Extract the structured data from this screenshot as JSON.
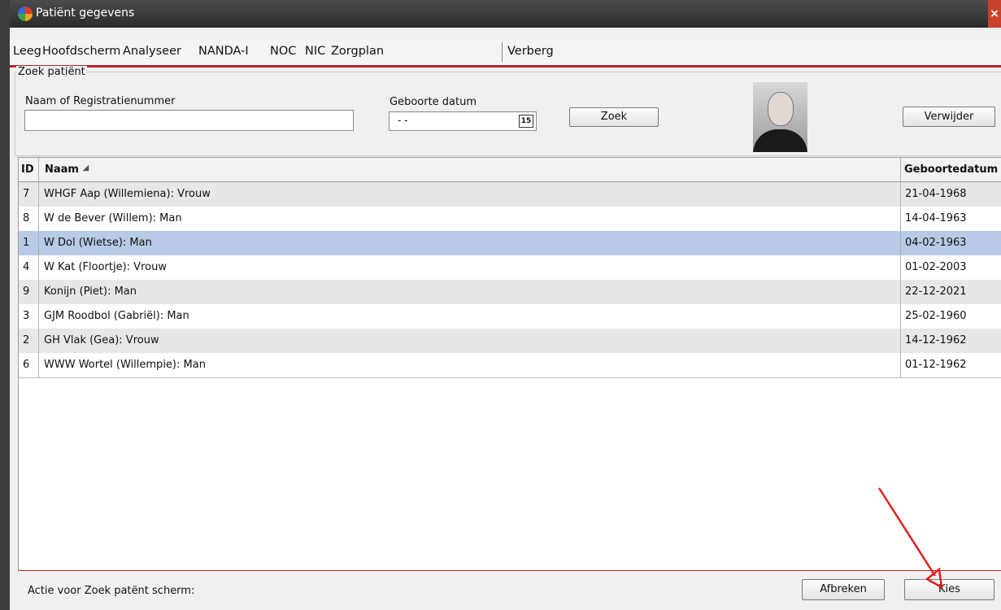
{
  "window": {
    "title": "Patiënt gegevens",
    "close": "×"
  },
  "menu": {
    "items": [
      "Leeg",
      "Hoofdscherm",
      "Analyseer",
      "NANDA-I",
      "NOC",
      "NIC",
      "Zorgplan",
      "Verberg"
    ]
  },
  "search": {
    "group_label": "Zoek patiënt",
    "name_label": "Naam of Registratienummer",
    "name_value": "",
    "dob_label": "Geboorte datum",
    "dob_value": "- -",
    "calendar_icon_text": "15",
    "search_button": "Zoek",
    "delete_button": "Verwijder"
  },
  "table": {
    "columns": {
      "id": "ID",
      "name": "Naam",
      "dob": "Geboortedatum"
    },
    "selected_index": 2,
    "rows": [
      {
        "id": "7",
        "name": "WHGF Aap  (Willemiena): Vrouw",
        "dob": "21-04-1968"
      },
      {
        "id": "8",
        "name": "W de Bever  (Willem): Man",
        "dob": "14-04-1963"
      },
      {
        "id": "1",
        "name": "W Dol  (Wietse): Man",
        "dob": "04-02-1963"
      },
      {
        "id": "4",
        "name": "W Kat  (Floortje): Vrouw",
        "dob": "01-02-2003"
      },
      {
        "id": "9",
        "name": " Konijn  (Piet): Man",
        "dob": "22-12-2021"
      },
      {
        "id": "3",
        "name": "GJM Roodbol  (Gabriël): Man",
        "dob": "25-02-1960"
      },
      {
        "id": "2",
        "name": "GH Vlak  (Gea): Vrouw",
        "dob": "14-12-1962"
      },
      {
        "id": "6",
        "name": "WWW Wortel  (Willempie): Man",
        "dob": "01-12-1962"
      }
    ]
  },
  "footer": {
    "status": "Actie voor Zoek patënt scherm:",
    "cancel_button": "Afbreken",
    "choose_button": "Kies"
  },
  "colors": {
    "accent": "#b4272a",
    "selected_row": "#b7cae6",
    "odd_row": "#e7e7e7",
    "annotation_arrow": "#e0201c"
  }
}
